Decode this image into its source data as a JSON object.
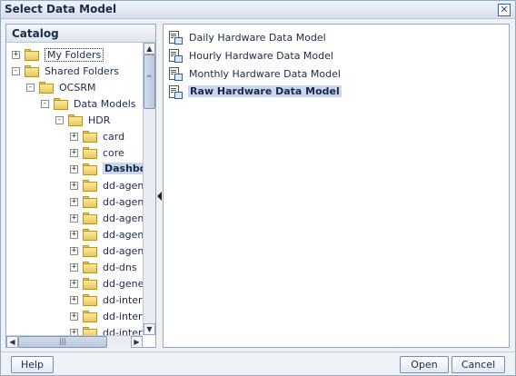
{
  "dialog": {
    "title": "Select Data Model"
  },
  "catalog": {
    "title": "Catalog",
    "tree": [
      {
        "label": "My Folders",
        "expander": "+",
        "depth": 0,
        "state": "focused"
      },
      {
        "label": "Shared Folders",
        "expander": "-",
        "depth": 0,
        "state": "open"
      },
      {
        "label": "OCSRM",
        "expander": "-",
        "depth": 1,
        "state": "open"
      },
      {
        "label": "Data Models",
        "expander": "-",
        "depth": 2,
        "state": "open"
      },
      {
        "label": "HDR",
        "expander": "-",
        "depth": 3,
        "state": "open"
      },
      {
        "label": "card",
        "expander": "+",
        "depth": 4,
        "state": "closed"
      },
      {
        "label": "core",
        "expander": "+",
        "depth": 4,
        "state": "closed"
      },
      {
        "label": "Dashboa",
        "expander": "+",
        "depth": 4,
        "state": "selected"
      },
      {
        "label": "dd-agent",
        "expander": "+",
        "depth": 4,
        "state": "closed"
      },
      {
        "label": "dd-agent",
        "expander": "+",
        "depth": 4,
        "state": "closed"
      },
      {
        "label": "dd-agent",
        "expander": "+",
        "depth": 4,
        "state": "closed"
      },
      {
        "label": "dd-agent",
        "expander": "+",
        "depth": 4,
        "state": "closed"
      },
      {
        "label": "dd-agent",
        "expander": "+",
        "depth": 4,
        "state": "closed"
      },
      {
        "label": "dd-dns",
        "expander": "+",
        "depth": 4,
        "state": "closed"
      },
      {
        "label": "dd-gener",
        "expander": "+",
        "depth": 4,
        "state": "closed"
      },
      {
        "label": "dd-interfa",
        "expander": "+",
        "depth": 4,
        "state": "closed"
      },
      {
        "label": "dd-interfa",
        "expander": "+",
        "depth": 4,
        "state": "closed"
      },
      {
        "label": "dd-interfa",
        "expander": "+",
        "depth": 4,
        "state": "closed"
      }
    ],
    "scroll_up_icon": "triangle-up",
    "scroll_down_icon": "triangle-down",
    "scroll_left_icon": "triangle-left",
    "scroll_right_icon": "triangle-right"
  },
  "models": {
    "items": [
      {
        "label": "Daily Hardware Data Model",
        "selected": false
      },
      {
        "label": "Hourly Hardware Data Model",
        "selected": false
      },
      {
        "label": "Monthly Hardware Data Model",
        "selected": false
      },
      {
        "label": "Raw Hardware Data Model",
        "selected": true
      }
    ]
  },
  "footer": {
    "help_label": "Help",
    "open_label": "Open",
    "cancel_label": "Cancel"
  },
  "colors": {
    "selection": "#c9d6ec",
    "border": "#9aa8bd",
    "panel_bg": "#eef1f6"
  }
}
